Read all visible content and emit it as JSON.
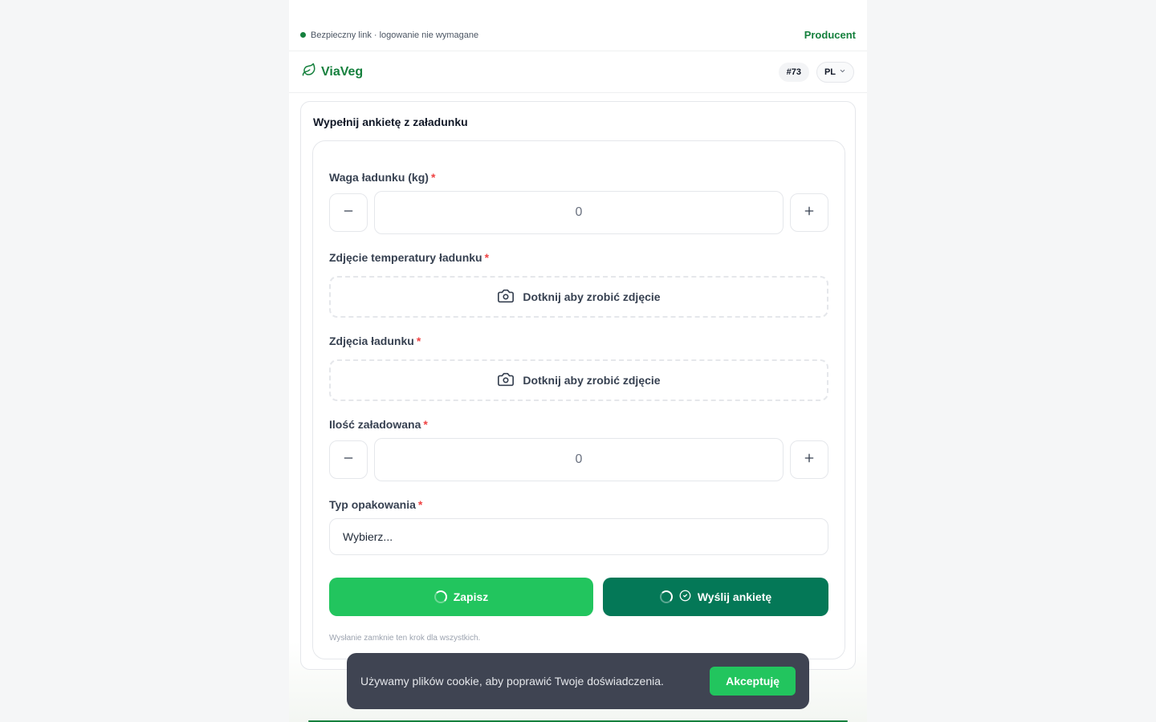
{
  "topbar": {
    "secure_text": "Bezpieczny link · logowanie nie wymagane",
    "role": "Producent"
  },
  "header": {
    "brand": "ViaVeg",
    "brand_icon": "leaf-icon",
    "order_id": "#73",
    "language": "PL"
  },
  "form": {
    "title": "Wypełnij ankietę z załadunku",
    "fields": [
      {
        "label": "Waga ładunku (kg)",
        "required_mark": "*",
        "type": "stepper",
        "value": "0"
      },
      {
        "label": "Zdjęcie temperatury ładunku",
        "required_mark": "*",
        "type": "photo",
        "action_text": "Dotknij aby zrobić zdjęcie"
      },
      {
        "label": "Zdjęcia ładunku",
        "required_mark": "*",
        "type": "photo",
        "action_text": "Dotknij aby zrobić zdjęcie"
      },
      {
        "label": "Ilość załadowana",
        "required_mark": "*",
        "type": "stepper",
        "value": "0"
      },
      {
        "label": "Typ opakowania",
        "required_mark": "*",
        "type": "select",
        "value": "Wybierz..."
      }
    ],
    "save_label": "Zapisz",
    "send_label": "Wyślij ankietę",
    "note": "Wysłanie zamknie ten krok dla wszystkich."
  },
  "cookie": {
    "text": "Używamy plików cookie, aby poprawić Twoje doświadczenia.",
    "accept_label": "Akceptuję"
  },
  "colors": {
    "brand_green": "#15803d",
    "save_button": "#22c55e",
    "send_button": "#047857",
    "required": "#ef4444",
    "cookie_bg": "#3f4452"
  }
}
